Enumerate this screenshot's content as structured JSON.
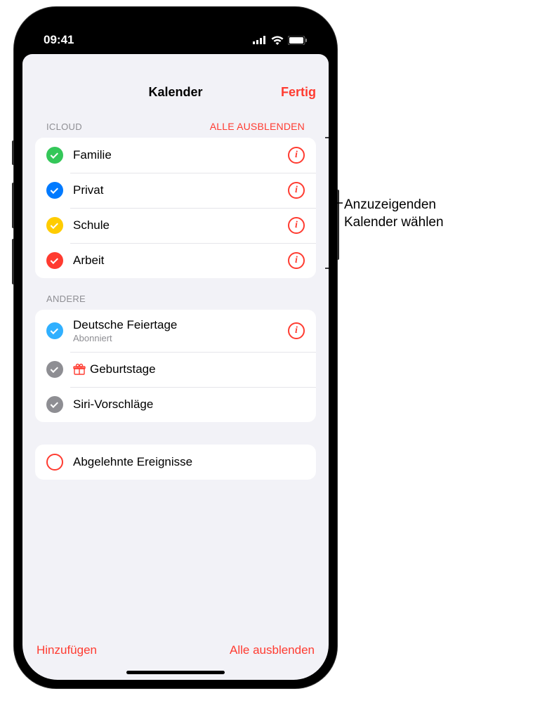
{
  "status_bar": {
    "time": "09:41"
  },
  "sheet": {
    "title": "Kalender",
    "done_label": "Fertig"
  },
  "sections": {
    "icloud": {
      "label": "ICLOUD",
      "action_label": "ALLE AUSBLENDEN",
      "items": [
        {
          "label": "Familie",
          "color": "#34c759",
          "checked": true,
          "has_info": true
        },
        {
          "label": "Privat",
          "color": "#007aff",
          "checked": true,
          "has_info": true
        },
        {
          "label": "Schule",
          "color": "#ffcc00",
          "checked": true,
          "has_info": true
        },
        {
          "label": "Arbeit",
          "color": "#ff3b30",
          "checked": true,
          "has_info": true
        }
      ]
    },
    "andere": {
      "label": "ANDERE",
      "items": [
        {
          "label": "Deutsche Feiertage",
          "sublabel": "Abonniert",
          "color": "#30b0ff",
          "checked": true,
          "has_info": true
        },
        {
          "label": "Geburtstage",
          "icon": "gift",
          "color": "#8e8e93",
          "checked": true,
          "has_info": false
        },
        {
          "label": "Siri-Vorschläge",
          "color": "#8e8e93",
          "checked": true,
          "has_info": false
        }
      ]
    },
    "declined": {
      "items": [
        {
          "label": "Abgelehnte Ereignisse",
          "checked": false
        }
      ]
    }
  },
  "bottom": {
    "add_label": "Hinzufügen",
    "hide_all_label": "Alle ausblenden"
  },
  "callout": {
    "line1": "Anzuzeigenden",
    "line2": "Kalender wählen"
  }
}
